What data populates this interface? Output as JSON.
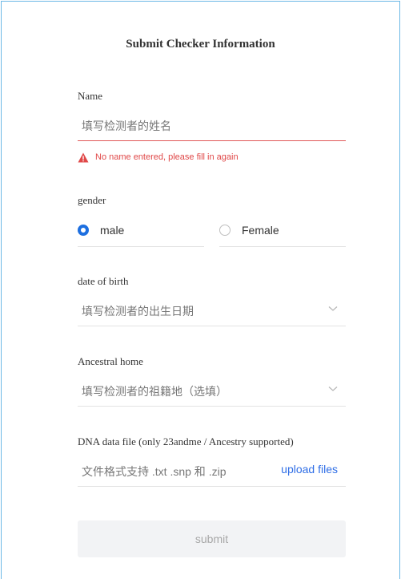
{
  "form": {
    "title": "Submit Checker Information",
    "name": {
      "label": "Name",
      "placeholder": "填写检测者的姓名",
      "error": "No name entered, please fill in again"
    },
    "gender": {
      "label": "gender",
      "options": [
        {
          "label": "male",
          "selected": true
        },
        {
          "label": "Female",
          "selected": false
        }
      ]
    },
    "dob": {
      "label": "date of birth",
      "placeholder": "填写检测者的出生日期"
    },
    "ancestral": {
      "label": "Ancestral home",
      "placeholder": "填写检测者的祖籍地（选填）"
    },
    "dna": {
      "label": "DNA data file (only 23andme / Ancestry supported)",
      "hint": "文件格式支持 .txt .snp 和 .zip",
      "upload_label": "upload files"
    },
    "submit_label": "submit"
  },
  "colors": {
    "accent": "#1d6fe0",
    "error": "#e04848",
    "link": "#2f6ee6"
  }
}
